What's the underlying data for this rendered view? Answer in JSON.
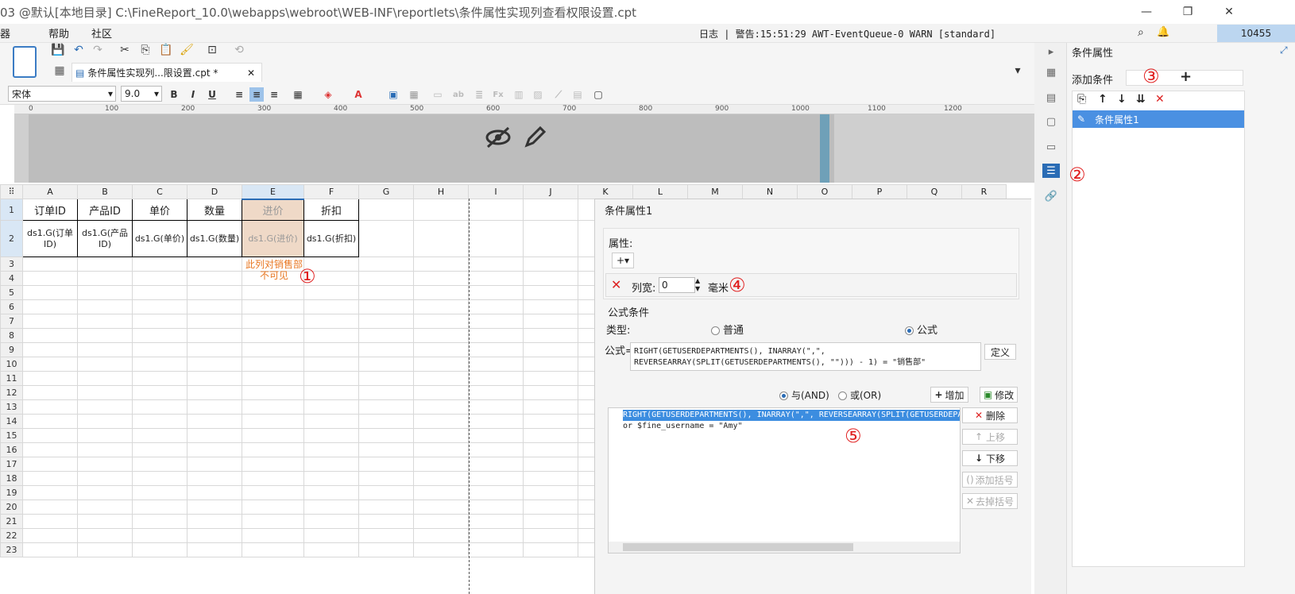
{
  "window": {
    "title": "03 @默认[本地目录]    C:\\FineReport_10.0\\webapps\\webroot\\WEB-INF\\reportlets\\条件属性实现列查看权限设置.cpt"
  },
  "menu": {
    "items": [
      "器",
      "帮助",
      "社区"
    ]
  },
  "log": {
    "text": "日志 | 警告:15:51:29 AWT-EventQueue-0 WARN [standard]"
  },
  "counter": "10455",
  "tab": {
    "label": "条件属性实现列...限设置.cpt *"
  },
  "format": {
    "font": "宋体",
    "size": "9.0"
  },
  "ruler": {
    "ticks": [
      "0",
      "100",
      "200",
      "300",
      "400",
      "500",
      "600",
      "700",
      "800",
      "900",
      "1000",
      "1100",
      "1200"
    ]
  },
  "sheet": {
    "columns": [
      "A",
      "B",
      "C",
      "D",
      "E",
      "F",
      "G",
      "H",
      "I",
      "J",
      "K",
      "L",
      "M",
      "N",
      "O",
      "P",
      "Q",
      "R"
    ],
    "rows": [
      "1",
      "2",
      "3",
      "4",
      "5",
      "6",
      "7",
      "8",
      "9",
      "10",
      "11",
      "12",
      "13",
      "14",
      "15",
      "16",
      "17",
      "18",
      "19",
      "20",
      "21",
      "22",
      "23"
    ],
    "headers": [
      "订单ID",
      "产品ID",
      "单价",
      "数量",
      "进价",
      "折扣"
    ],
    "body": [
      "ds1.G(订单ID)",
      "ds1.G(产品ID)",
      "ds1.G(单价)",
      "ds1.G(数量)",
      "ds1.G(进价)",
      "ds1.G(折扣)"
    ],
    "note": "此列对销售部\n不可见"
  },
  "annotations": {
    "a1": "①",
    "a2": "②",
    "a3": "③",
    "a4": "④",
    "a5": "⑤"
  },
  "right_panel": {
    "title": "条件属性",
    "add_label": "添加条件",
    "item": "条件属性1"
  },
  "dialog": {
    "title": "条件属性1",
    "attr_label": "属性:",
    "colwidth_label": "列宽:",
    "colwidth_value": "0",
    "unit": "毫米",
    "formula_cond": "公式条件",
    "type_label": "类型:",
    "type_normal": "普通",
    "type_formula": "公式",
    "formula_label": "公式=",
    "formula_line1": "RIGHT(GETUSERDEPARTMENTS(), INARRAY(\",\",",
    "formula_line2": "REVERSEARRAY(SPLIT(GETUSERDEPARTMENTS(), \"\"))) - 1) = \"销售部\"",
    "define_btn": "定义",
    "and_label": "与(AND)",
    "or_label": "或(OR)",
    "add_btn": "增加",
    "modify_btn": "修改",
    "cond_line1": "RIGHT(GETUSERDEPARTMENTS(), INARRAY(\",\", REVERSEARRAY(SPLIT(GETUSERDEPART",
    "cond_line2": "or  $fine_username = \"Amy\"",
    "delete_btn": "删除",
    "up_btn": "上移",
    "down_btn": "下移",
    "add_paren_btn": "添加括号",
    "remove_paren_btn": "去掉括号"
  }
}
